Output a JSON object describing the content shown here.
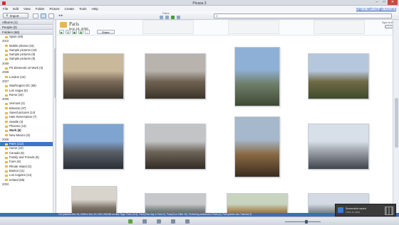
{
  "window": {
    "title": "Picasa 3",
    "min": "–",
    "max": "□",
    "close": "✕"
  },
  "menu": {
    "items": [
      "File",
      "Edit",
      "View",
      "Folder",
      "Picture",
      "Create",
      "Tools",
      "Help"
    ],
    "signin": "Sign in with Google Account"
  },
  "toolbar": {
    "import_label": "Import",
    "filters_label": "Filters",
    "search_placeholder": ""
  },
  "sidebar": {
    "groups": [
      {
        "label": "Albums (1)"
      },
      {
        "label": "People (0)"
      },
      {
        "label": "Folders (68)"
      }
    ],
    "rows": [
      {
        "type": "folder",
        "label": "Spain (45)"
      },
      {
        "type": "year",
        "label": "2010"
      },
      {
        "type": "folder",
        "label": "Mobile photos (16)"
      },
      {
        "type": "folder",
        "label": "Sample pictures (19)"
      },
      {
        "type": "folder",
        "label": "Sample pictures (9)"
      },
      {
        "type": "folder",
        "label": "Sample pictures (9)"
      },
      {
        "type": "year",
        "label": "2009"
      },
      {
        "type": "folder",
        "label": "PS Elements 10 Work (3)"
      },
      {
        "type": "year",
        "label": "2008"
      },
      {
        "type": "folder",
        "label": "London (44)"
      },
      {
        "type": "year",
        "label": "2007"
      },
      {
        "type": "folder",
        "label": "Washington DC (59)"
      },
      {
        "type": "folder",
        "label": "Las Vegas (6)"
      },
      {
        "type": "folder",
        "label": "Rome (24)"
      },
      {
        "type": "year",
        "label": "2006"
      },
      {
        "type": "folder",
        "label": "Vermont (4)"
      },
      {
        "type": "folder",
        "label": "Bimelos (47)"
      },
      {
        "type": "folder",
        "label": "Saved pictures (14)"
      },
      {
        "type": "folder",
        "label": "Hale Reservation (7)"
      },
      {
        "type": "folder",
        "label": "Seattle (4)"
      },
      {
        "type": "folder",
        "label": "Phoenix (13)"
      },
      {
        "type": "folder",
        "label": "Work (6)",
        "bold": true
      },
      {
        "type": "folder",
        "label": "New Mexico (9)"
      },
      {
        "type": "year",
        "label": "2005"
      },
      {
        "type": "folder",
        "label": "Paris (112)",
        "selected": true
      },
      {
        "type": "folder",
        "label": "Home (10)"
      },
      {
        "type": "folder",
        "label": "Canada (5)"
      },
      {
        "type": "folder",
        "label": "Family and Friends (6)"
      },
      {
        "type": "folder",
        "label": "Farm (6)"
      },
      {
        "type": "folder",
        "label": "Rhode Island (3)"
      },
      {
        "type": "folder",
        "label": "Boston (11)"
      },
      {
        "type": "folder",
        "label": "Los Angeles (14)"
      },
      {
        "type": "folder",
        "label": "Ireland (86)"
      },
      {
        "type": "year",
        "label": "2002"
      }
    ]
  },
  "folder_header": {
    "title": "Paris",
    "date": "Nov 18, 2005",
    "share_label": "Share",
    "sync_label": "Sync to Web"
  },
  "thumbnails": [
    {
      "name": "couple-bench",
      "colors": [
        "#c9b89a",
        "#7a6a58",
        "#3a342c"
      ]
    },
    {
      "name": "seine-trees",
      "colors": [
        "#b8b4ad",
        "#6f6252",
        "#3d342a"
      ]
    },
    {
      "name": "eiffel-tower-1",
      "colors": [
        "#8fb0d6",
        "#6f7f6a",
        "#3e4a34"
      ]
    },
    {
      "name": "park-trees",
      "colors": [
        "#b5c7dc",
        "#6f6b46",
        "#3f4a2c"
      ]
    },
    {
      "name": "bridge-statues",
      "colors": [
        "#7fa4d0",
        "#5a5f66",
        "#2a2f37"
      ]
    },
    {
      "name": "tree-avenue",
      "colors": [
        "#c2c4c6",
        "#6d6458",
        "#342c24"
      ]
    },
    {
      "name": "garden-statue",
      "colors": [
        "#a6b8cc",
        "#8a6a44",
        "#3a2c1e"
      ]
    },
    {
      "name": "street-scene",
      "colors": [
        "#d7dfe9",
        "#9a9fa6",
        "#40454d"
      ]
    },
    {
      "name": "people-park",
      "colors": [
        "#d8d4cc",
        "#7e7468",
        "#3a332c"
      ]
    },
    {
      "name": "arch-view",
      "colors": [
        "#c6c8ca",
        "#7b7d7f",
        "#444"
      ]
    },
    {
      "name": "market-stall",
      "colors": [
        "#c9d4c0",
        "#a98d5c",
        "#4a3a24"
      ]
    },
    {
      "name": "city-street",
      "colors": [
        "#d3dae3",
        "#8f969e",
        "#3e444b"
      ]
    }
  ],
  "status": {
    "text": "112 pictures    Nov 18, 2005 to Nov 19, 2011    262448 on disk    Tags: Paris (104), Paris(First day in Paris 9), Paris(Tour Eiffel 26), Perfecting weekend in Paris (4), Paris(Jardin des Tuileries 9)"
  },
  "notice": {
    "line1": "Screenshot saved",
    "line2": "Click to view"
  }
}
